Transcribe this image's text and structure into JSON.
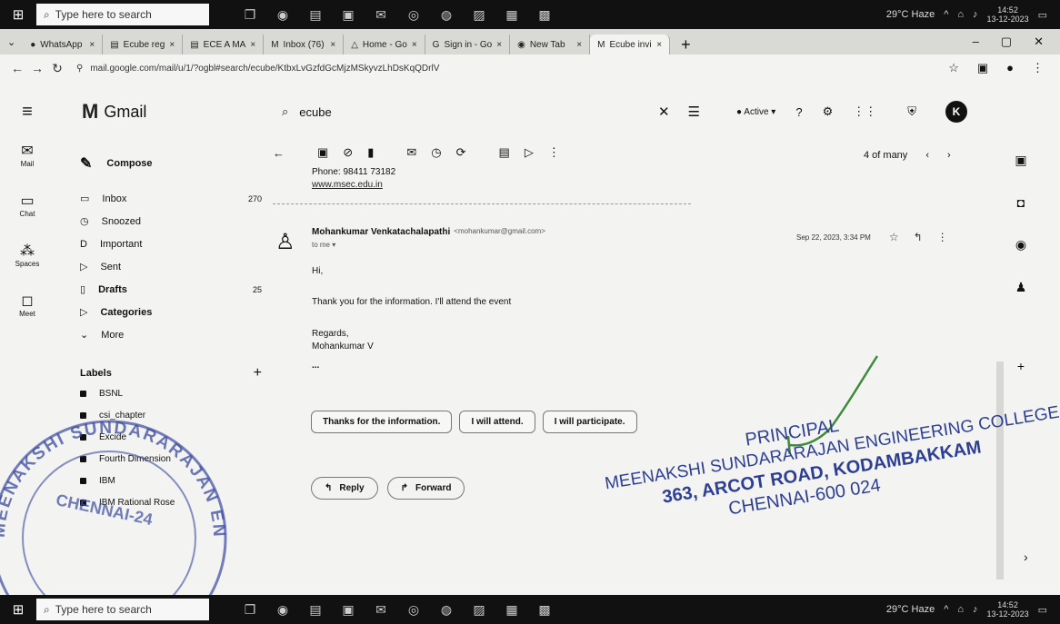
{
  "taskbar": {
    "search_placeholder": "Type here to search",
    "tray_weather": "29°C Haze",
    "clock_time": "14:52",
    "clock_date": "13-12-2023"
  },
  "browser": {
    "tabs": [
      {
        "label": "WhatsApp"
      },
      {
        "label": "Ecube reg"
      },
      {
        "label": "ECE A MA"
      },
      {
        "label": "Inbox (76)"
      },
      {
        "label": "Home - Go"
      },
      {
        "label": "Sign in - Go"
      },
      {
        "label": "New Tab"
      },
      {
        "label": "Ecube invi",
        "active": true
      }
    ],
    "url": "mail.google.com/mail/u/1/?ogbl#search/ecube/KtbxLvGzfdGcMjzMSkyvzLhDsKqQDrlV"
  },
  "gmail": {
    "brand": "Gmail",
    "search_value": "ecube",
    "status": "Active",
    "avatar_letter": "K",
    "rail": [
      {
        "label": "Mail",
        "icon": "mail-icon"
      },
      {
        "label": "Chat",
        "icon": "chat-icon"
      },
      {
        "label": "Spaces",
        "icon": "spaces-icon"
      },
      {
        "label": "Meet",
        "icon": "meet-icon"
      }
    ],
    "compose": "Compose",
    "nav": [
      {
        "label": "Inbox",
        "count": "270"
      },
      {
        "label": "Snoozed",
        "count": ""
      },
      {
        "label": "Important",
        "count": ""
      },
      {
        "label": "Sent",
        "count": ""
      },
      {
        "label": "Drafts",
        "count": "25"
      },
      {
        "label": "Categories",
        "count": ""
      },
      {
        "label": "More",
        "count": ""
      }
    ],
    "labels_title": "Labels",
    "labels": [
      "BSNL",
      "csi_chapter",
      "Excide",
      "Fourth Dimension",
      "IBM",
      "IBM Rational Rose"
    ],
    "pager": "4 of many",
    "quoted": {
      "phone": "Phone: 98411 73182",
      "web": "www.msec.edu.in"
    },
    "message": {
      "sender": "Mohankumar Venkatachalapathi",
      "sender_email": "<mohankumar@gmail.com>",
      "to": "to me",
      "date": "Sep 22, 2023, 3:34 PM",
      "greeting": "Hi,",
      "body": "Thank you for the information. I'll attend the event",
      "regards": "Regards,",
      "signoff": "Mohankumar V",
      "ellipsis": "..."
    },
    "smart_replies": [
      "Thanks for the information.",
      "I will attend.",
      "I will participate."
    ],
    "reply_label": "Reply",
    "forward_label": "Forward"
  },
  "stamps": {
    "seal_top": "MEENAKSHI SUNDARARAJAN ENGINEERING",
    "seal_center": "CHENNAI-24",
    "principal": "PRINCIPAL",
    "college": "MEENAKSHI SUNDARARAJAN ENGINEERING COLLEGE",
    "address": "363, ARCOT ROAD, KODAMBAKKAM",
    "city": "CHENNAI-600 024"
  }
}
